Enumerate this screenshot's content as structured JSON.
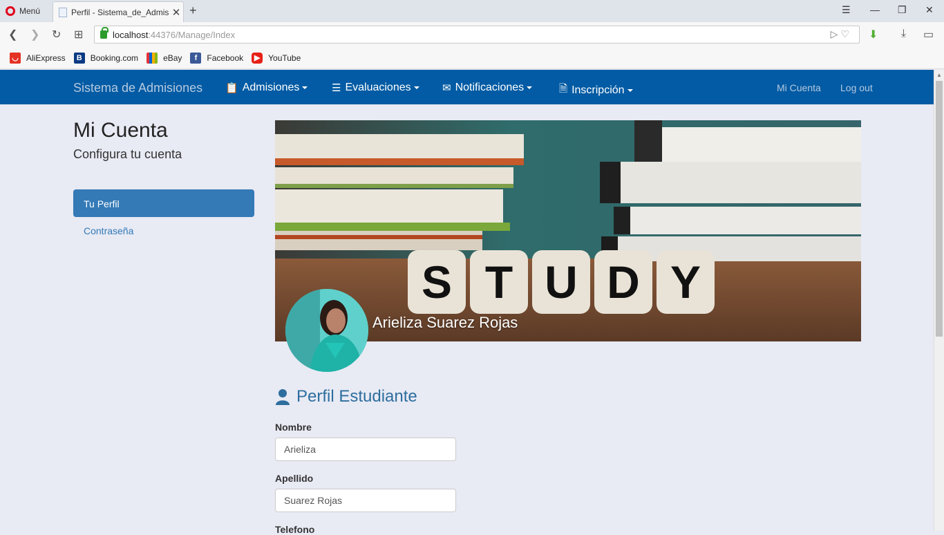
{
  "browser": {
    "menu_label": "Menú",
    "tab_title": "Perfil - Sistema_de_Admisi",
    "url_host": "localhost",
    "url_path": ":44376/Manage/Index",
    "bookmarks": [
      "AliExpress",
      "Booking.com",
      "eBay",
      "Facebook",
      "YouTube"
    ]
  },
  "navbar": {
    "brand": "Sistema de Admisiones",
    "items": [
      {
        "label": "Admisiones",
        "icon": "clipboard-icon"
      },
      {
        "label": "Evaluaciones",
        "icon": "list-icon"
      },
      {
        "label": "Notificaciones",
        "icon": "envelope-icon"
      },
      {
        "label": "Inscripción",
        "icon": "file-icon"
      }
    ],
    "right": [
      "Mi Cuenta",
      "Log out"
    ]
  },
  "sidebar": {
    "title": "Mi Cuenta",
    "subtitle": "Configura tu cuenta",
    "items": [
      {
        "label": "Tu Perfil",
        "active": true
      },
      {
        "label": "Contraseña",
        "active": false
      }
    ]
  },
  "banner": {
    "word": "STUDY",
    "name": "Arieliza Suarez Rojas"
  },
  "form": {
    "title": "Perfil Estudiante",
    "fields": [
      {
        "label": "Nombre",
        "value": "Arieliza"
      },
      {
        "label": "Apellido",
        "value": "Suarez Rojas"
      },
      {
        "label": "Telefono",
        "value": ""
      }
    ]
  },
  "colors": {
    "navbar": "#025ba4",
    "accent": "#337ab7",
    "background": "#e8eaf4"
  }
}
